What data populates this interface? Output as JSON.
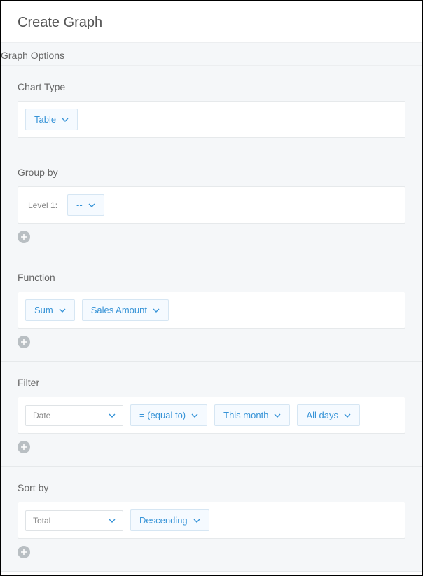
{
  "header": {
    "title": "Create Graph"
  },
  "subheader": "Graph Options",
  "chartType": {
    "label": "Chart Type",
    "value": "Table"
  },
  "groupBy": {
    "label": "Group by",
    "levelLabel": "Level 1:",
    "value": "--"
  },
  "function": {
    "label": "Function",
    "aggregate": "Sum",
    "field": "Sales Amount"
  },
  "filter": {
    "label": "Filter",
    "field": "Date",
    "operator": "= (equal to)",
    "period": "This month",
    "days": "All days"
  },
  "sortBy": {
    "label": "Sort by",
    "field": "Total",
    "direction": "Descending"
  }
}
